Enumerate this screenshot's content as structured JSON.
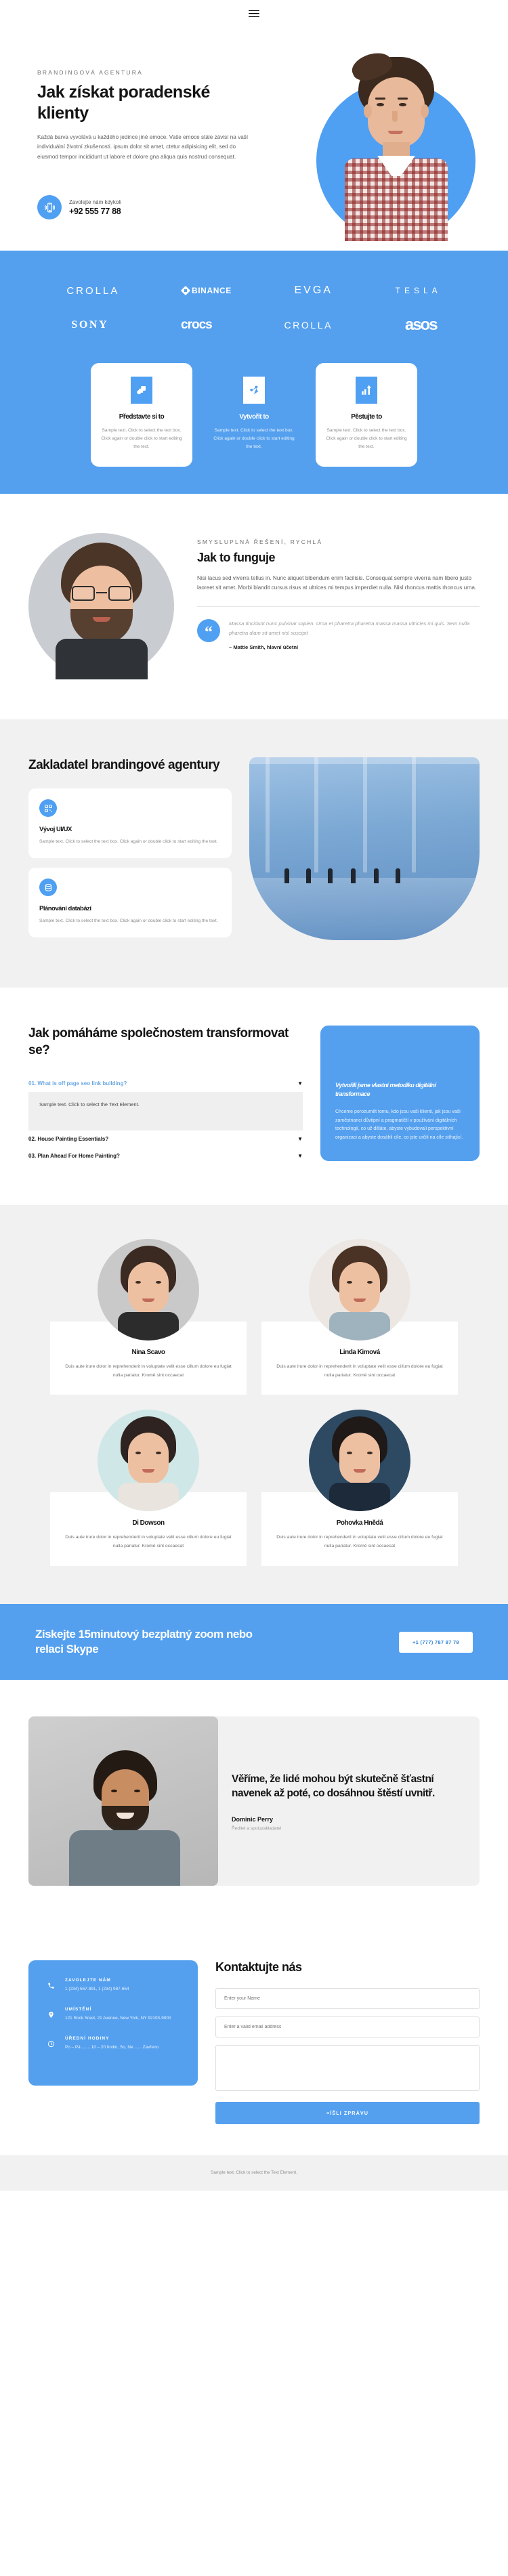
{
  "nav": {
    "menu_label": "menu"
  },
  "hero": {
    "eyebrow": "BRANDINGOVÁ AGENTURA",
    "title": "Jak získat poradenské klienty",
    "paragraph": "Každá barva vyvolává u každého jedince jiné emoce. Vaše emoce stále závisí na vaší individuální životní zkušenosti. ipsum dolor sit amet, ctetur adipisicing elit, sed do eiusmod tempor incididunt ut labore et dolore gna aliqua quis nostrud consequat.",
    "call_label": "Zavolejte nám kdykoli",
    "call_number": "+92 555 77 88",
    "phone_icon": "phone-ringing-icon"
  },
  "logos": {
    "row1": [
      "CROLLA",
      "BINANCE",
      "EVGA",
      "TESLA"
    ],
    "row2": [
      "SONY",
      "crocs",
      "CROLLA",
      "asos"
    ]
  },
  "feature_cards": [
    {
      "icon": "layers-icon",
      "title": "Představte si to",
      "text": "Sample text. Click to select the text box. Click again or double click to start editing the text."
    },
    {
      "icon": "node-network-icon",
      "title": "Vytvořit to",
      "text": "Sample text. Click to select the text box. Click again or double click to start editing the text."
    },
    {
      "icon": "growth-chart-icon",
      "title": "Pěstujte to",
      "text": "Sample text. Click to select the text box. Click again or double click to start editing the text."
    }
  ],
  "how": {
    "eyebrow": "SMYSLUPLNÁ ŘEŠENÍ, RYCHLÁ",
    "title": "Jak to funguje",
    "paragraph": "Nisi lacus sed viverra tellus in. Nunc aliquet bibendum enim facilisis. Consequat sempre viverra nam libero justo laoreet sit amet. Morbi blandit cursus risus at ultrices mi tempus imperdiet nulla. Nisl rhoncus mattis rhoncus urna.",
    "quote_icon": "quote-mark-icon",
    "quote": "Massa tincidunt nunc pulvinar sapien. Urna et pharetra pharetra massa massa ultricies mi quis. Sem nulla pharetra diam sit amet nisl suscipit",
    "quote_author": "– Mattie Smith, hlavní účetní"
  },
  "founder": {
    "title": "Zakladatel brandingové agentury",
    "cards": [
      {
        "icon": "qr-code-icon",
        "title": "Vývoj UI/UX",
        "text": "Sample text. Click to select the text box. Click again or double click to start editing the text."
      },
      {
        "icon": "database-icon",
        "title": "Plánování databází",
        "text": "Sample text. Click to select the text box. Click again or double click to start editing the text."
      }
    ]
  },
  "faq": {
    "title": "Jak pomáháme společnostem transformovat se?",
    "items": [
      {
        "label": "01. What is off page seo link building?",
        "open": true,
        "body": "Sample text. Click to select the Text Element."
      },
      {
        "label": "02. House Painting Essentials?",
        "open": false,
        "body": ""
      },
      {
        "label": "03. Plan Ahead For Home Painting?",
        "open": false,
        "body": ""
      }
    ],
    "caret_icon": "chevron-down-icon",
    "panel": {
      "title": "Vytvořili jsme vlastní metodiku digitální transformace",
      "text": "Chceme porozumět tomu, kdo jsou vaši klienti, jak jsou vaši zaměstnanci důvtipní a pragmatičtí v používání digitálních technologií, co už děláte, abyste vybudovali perspektivní organizaci a abyste dosáhli cíle, co jste určili na cíle stíhající."
    }
  },
  "team": {
    "members": [
      {
        "name": "Nina Scavo",
        "text": "Duis aute irure dolor in reprehenderit in voluptate velit esse cillum dolore eu fugiat nulla pariatur. Kromě sint occaecat",
        "hair": "#3b2a22",
        "body": "#2c2c2c",
        "bg": "#c9c9c9"
      },
      {
        "name": "Linda Kimová",
        "text": "Duis aute irure dolor in reprehenderit in voluptate velit esse cillum dolore eu fugiat nulla pariatur. Kromě sint occaecat",
        "hair": "#4a3224",
        "body": "#9fb3bf",
        "bg": "#ece7e2"
      },
      {
        "name": "Di Dowson",
        "text": "Duis aute irure dolor in reprehenderit in voluptate velit esse cillum dolore eu fugiat nulla pariatur. Kromě sint occaecat",
        "hair": "#2e2320",
        "body": "#e9e4dd",
        "bg": "#cfe7e7"
      },
      {
        "name": "Pohovka Hnědá",
        "text": "Duis aute irure dolor in reprehenderit in voluptate velit esse cillum dolore eu fugiat nulla pariatur. Kromě sint occaecat",
        "hair": "#1f1a18",
        "body": "#1c2a3a",
        "bg": "#2e4a63"
      }
    ]
  },
  "zoom_cta": {
    "title": "Získejte 15minutový bezplatný zoom nebo relaci Skype",
    "button": "+1 (777) 787 87 78"
  },
  "testimonial": {
    "quote": "Věříme, že lidé mohou být skutečně šťastní navenek až poté, co dosáhnou štěstí uvnitř.",
    "name": "Dominic Perry",
    "role": "Ředitel a spoluzakladatel"
  },
  "contact": {
    "title": "Kontaktujte nás",
    "blocks": [
      {
        "icon": "phone-icon",
        "label": "ZAVOLEJTE NÁM",
        "value": "1 (234) 567-891, 1 (234) 987-654"
      },
      {
        "icon": "pin-icon",
        "label": "UMÍSTĚNÍ",
        "value": "121 Rock Sreet, 21 Avenue, New York, NY 92103-9000"
      },
      {
        "icon": "clock-icon",
        "label": "ÚŘEDNÍ HODINY",
        "value": "Po – Pá ....... 10 – 20 hodin, So, Ne ...... Zavřeno"
      }
    ],
    "fields": [
      {
        "name": "name-field",
        "placeholder": "Enter your Name"
      },
      {
        "name": "email-field",
        "placeholder": "Enter a valid email address"
      },
      {
        "name": "message-field",
        "placeholder": ""
      }
    ],
    "submit": "≡ÍŠLI ZPRÁVU"
  },
  "footer": {
    "text": "Sample text. Click to select the Text Element."
  },
  "colors": {
    "accent": "#54a0ef",
    "accent_dark": "#4f9ff2",
    "light_grey": "#f1f1f1",
    "text": "#141414"
  }
}
